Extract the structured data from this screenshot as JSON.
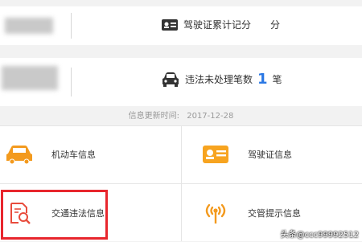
{
  "summary": {
    "license_points_label": "驾驶证累计记分",
    "license_points_unit": "分",
    "violations_label": "违法未处理笔数",
    "violations_count": "1",
    "violations_unit": "笔"
  },
  "update": {
    "label": "信息更新时间:",
    "date": "2017-12-28"
  },
  "menu": [
    {
      "label": "机动车信息",
      "icon": "car-icon"
    },
    {
      "label": "驾驶证信息",
      "icon": "license-card-icon"
    },
    {
      "label": "交通违法信息",
      "icon": "violation-search-icon"
    },
    {
      "label": "交管提示信息",
      "icon": "broadcast-icon"
    }
  ],
  "watermark": "头条@ccc99992512",
  "colors": {
    "accent_blue": "#2b78e4",
    "icon_orange": "#f39a1e",
    "highlight_red": "#e8262d"
  }
}
